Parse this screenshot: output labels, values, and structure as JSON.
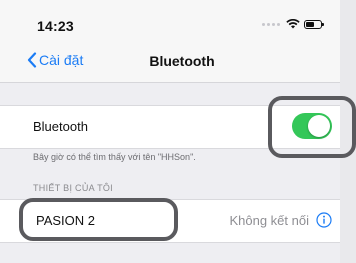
{
  "status_bar": {
    "time": "14:23"
  },
  "nav": {
    "back_label": "Cài đặt",
    "title": "Bluetooth"
  },
  "bluetooth_row": {
    "label": "Bluetooth",
    "toggle_on": true,
    "toggle_color": "#34c759"
  },
  "discoverable_note": "Bây giờ có thể tìm thấy với tên \"HHSon\".",
  "my_devices": {
    "header": "THIẾT BỊ CỦA TÔI",
    "items": [
      {
        "name": "PASION 2",
        "status": "Không kết nối",
        "icon": "info-icon"
      }
    ]
  },
  "colors": {
    "accent": "#1b7cf5",
    "annotation": "#5a5a5e"
  }
}
